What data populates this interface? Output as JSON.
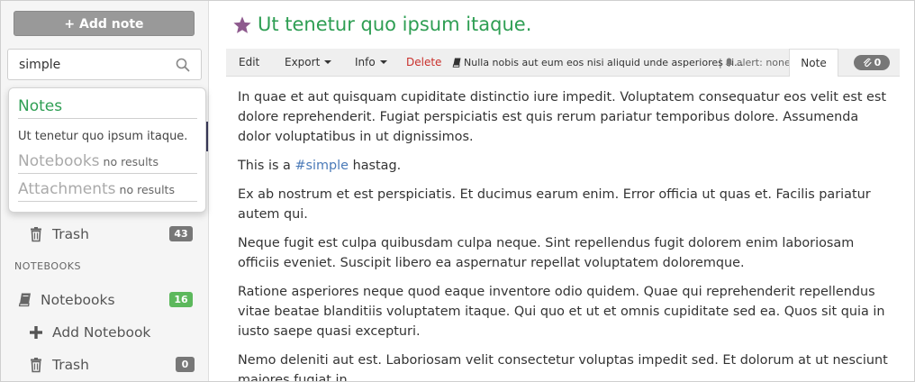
{
  "sidebar": {
    "add_note_label": "+ Add note",
    "search": {
      "value": "simple",
      "placeholder": ""
    },
    "items": [
      {
        "label": "Trash",
        "count": "43"
      },
      {
        "label": "Notebooks",
        "count": "16"
      },
      {
        "label": "Add Notebook"
      },
      {
        "label": "Trash",
        "count": "0"
      }
    ],
    "section_notebooks": "NOTEBOOKS"
  },
  "search_dropdown": {
    "notes_heading": "Notes",
    "note_result": "Ut tenetur quo ipsum itaque.",
    "notebooks_heading": "Notebooks",
    "notebooks_status": "no results",
    "attachments_heading": "Attachments",
    "attachments_status": "no results"
  },
  "note": {
    "title": "Ut tenetur quo ipsum itaque.",
    "toolbar": {
      "edit": "Edit",
      "export": "Export",
      "info": "Info",
      "delete": "Delete",
      "notebook": "Nulla nobis aut eum eos nisi aliquid unde asperiores si...",
      "separator": "|",
      "alert": "alert: none",
      "note_tab": "Note",
      "attachments_count": "0"
    },
    "paragraphs": {
      "p1": "In quae et aut quisquam cupiditate distinctio iure impedit. Voluptatem consequatur eos velit est est dolore reprehenderit. Fugiat perspiciatis est quis rerum pariatur temporibus dolore. Assumenda dolor voluptatibus in ut dignissimos.",
      "p2_before": "This is a ",
      "p2_tag": "#simple",
      "p2_after": " hastag.",
      "p3": "Ex ab nostrum et est perspiciatis. Et ducimus earum enim. Error officia ut quas et. Facilis pariatur autem qui.",
      "p4": "Neque fugit est culpa quibusdam culpa neque. Sint repellendus fugit dolorem enim laboriosam officiis eveniet. Suscipit libero ea aspernatur repellat voluptatem doloremque.",
      "p5": "Ratione asperiores neque quod eaque inventore odio quidem. Quae qui reprehenderit repellendus vitae beatae blanditiis voluptatem itaque. Qui quo et ut et omnis cupiditate sed ea. Quos sit quia in iusto saepe quasi excepturi.",
      "p6": "Nemo deleniti aut est. Laboriosam velit consectetur voluptas impedit sed. Et dolorum at ut nesciunt maiores fugiat in."
    }
  },
  "colors": {
    "accent_green": "#2e9e53",
    "star": "#8e5a8e",
    "hashtag": "#4a7ab8",
    "delete": "#c9302c",
    "badge_green": "#5cb85c",
    "badge_gray": "#777777"
  },
  "icons": {
    "search": "search-icon",
    "trash": "trash-icon",
    "notebook": "book-icon",
    "add": "plus-icon",
    "star": "star-icon",
    "alert": "bell-icon",
    "attachment": "paperclip-icon"
  }
}
